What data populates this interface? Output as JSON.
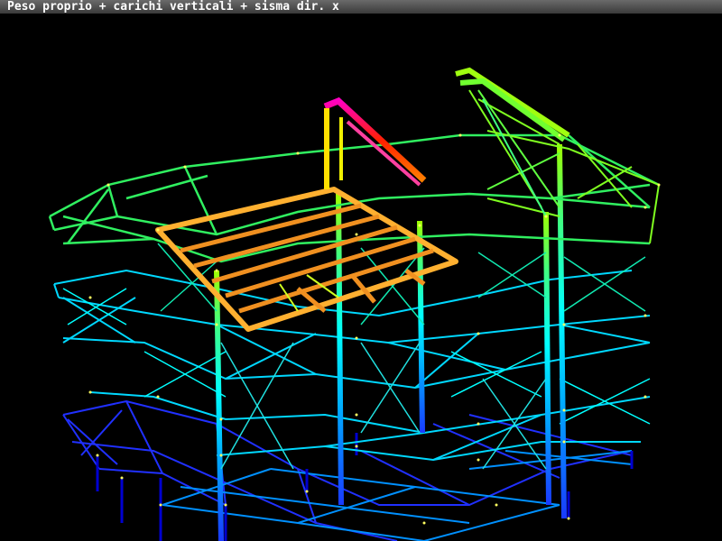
{
  "window": {
    "title": "Peso proprio + carichi verticali + sisma dir. x"
  },
  "viewport": {
    "background": "#000000",
    "color_scale": [
      "#0000ff",
      "#00a0ff",
      "#00ffff",
      "#40ff80",
      "#a0ff00",
      "#ffff00",
      "#ff8000",
      "#ff0000",
      "#ff00ff"
    ]
  }
}
